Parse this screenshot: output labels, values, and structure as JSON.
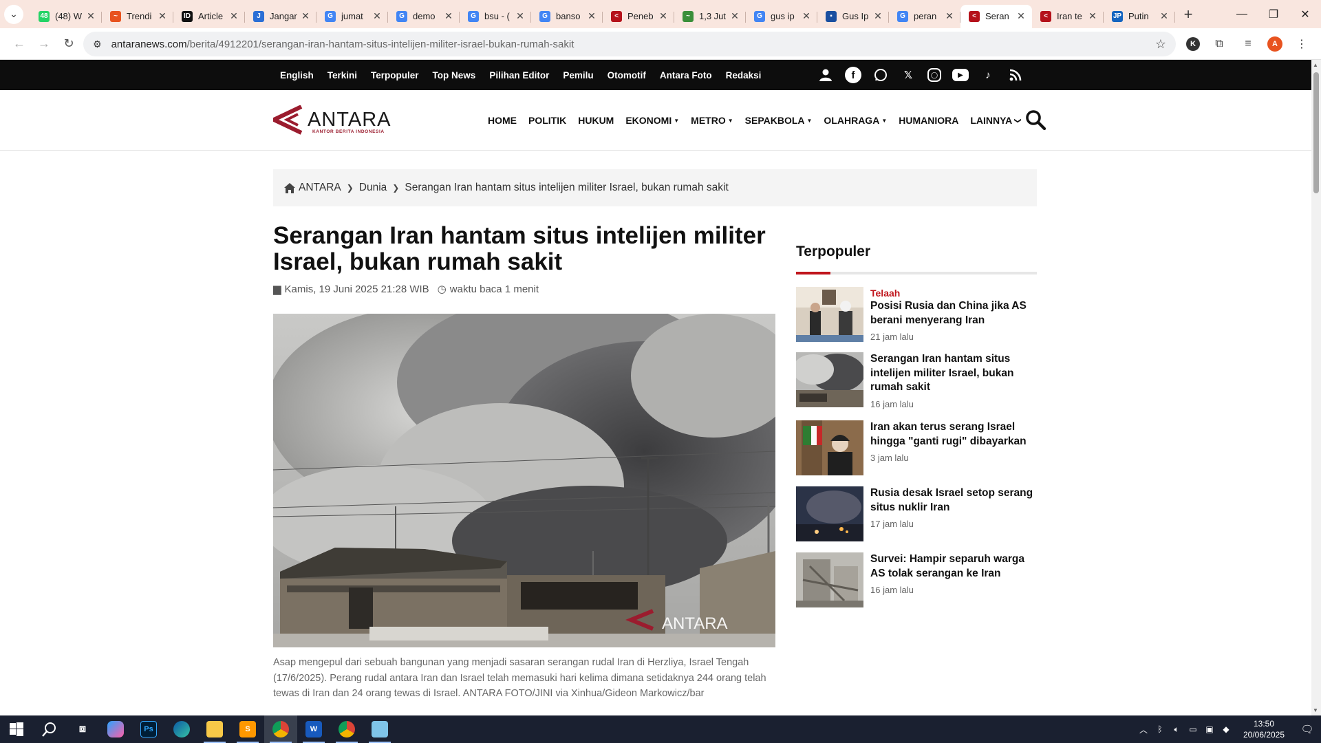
{
  "browser": {
    "tabs": [
      {
        "title": "(48) W",
        "fav_color": "#25d366",
        "fav_glyph": "48",
        "active": false
      },
      {
        "title": "Trendi",
        "fav_color": "#e8531f",
        "fav_glyph": "~",
        "active": false
      },
      {
        "title": "Article",
        "fav_color": "#111111",
        "fav_glyph": "ID",
        "active": false
      },
      {
        "title": "Jangar",
        "fav_color": "#2b6fd6",
        "fav_glyph": "J",
        "active": false
      },
      {
        "title": "jumat",
        "fav_color": "#4285f4",
        "fav_glyph": "G",
        "active": false
      },
      {
        "title": "demo",
        "fav_color": "#4285f4",
        "fav_glyph": "G",
        "active": false
      },
      {
        "title": "bsu - (",
        "fav_color": "#4285f4",
        "fav_glyph": "G",
        "active": false
      },
      {
        "title": "banso",
        "fav_color": "#4285f4",
        "fav_glyph": "G",
        "active": false
      },
      {
        "title": "Peneb",
        "fav_color": "#b5121b",
        "fav_glyph": "<",
        "active": false
      },
      {
        "title": "1,3 Jut",
        "fav_color": "#3a8f3a",
        "fav_glyph": "~",
        "active": false
      },
      {
        "title": "gus ip",
        "fav_color": "#4285f4",
        "fav_glyph": "G",
        "active": false
      },
      {
        "title": "Gus Ip",
        "fav_color": "#1a4fa0",
        "fav_glyph": "▪",
        "active": false
      },
      {
        "title": "peran",
        "fav_color": "#4285f4",
        "fav_glyph": "G",
        "active": false
      },
      {
        "title": "Seran",
        "fav_color": "#b5121b",
        "fav_glyph": "<",
        "active": true
      },
      {
        "title": "Iran te",
        "fav_color": "#b5121b",
        "fav_glyph": "<",
        "active": false
      },
      {
        "title": "Putin",
        "fav_color": "#1565c0",
        "fav_glyph": "JP",
        "active": false
      }
    ],
    "url_host": "antaranews.com",
    "url_path": "/berita/4912201/serangan-iran-hantam-situs-intelijen-militer-israel-bukan-rumah-sakit",
    "profile_initial": "A",
    "extension_initial": "K"
  },
  "topnav": [
    "English",
    "Terkini",
    "Terpopuler",
    "Top News",
    "Pilihan Editor",
    "Pemilu",
    "Otomotif",
    "Antara Foto",
    "Redaksi"
  ],
  "logo": {
    "name": "ANTARA",
    "tagline": "KANTOR BERITA INDONESIA",
    "accent": "#9b1c2e"
  },
  "mainnav": [
    {
      "label": "HOME",
      "dropdown": false
    },
    {
      "label": "POLITIK",
      "dropdown": false
    },
    {
      "label": "HUKUM",
      "dropdown": false
    },
    {
      "label": "EKONOMI",
      "dropdown": true
    },
    {
      "label": "METRO",
      "dropdown": true
    },
    {
      "label": "SEPAKBOLA",
      "dropdown": true
    },
    {
      "label": "OLAHRAGA",
      "dropdown": true
    },
    {
      "label": "HUMANIORA",
      "dropdown": false
    },
    {
      "label": "LAINNYA",
      "dropdown": true
    }
  ],
  "breadcrumb": [
    "ANTARA",
    "Dunia",
    "Serangan Iran hantam situs intelijen militer Israel, bukan rumah sakit"
  ],
  "article": {
    "title": "Serangan Iran hantam situs intelijen militer Israel, bukan rumah sakit",
    "date": "Kamis, 19 Juni 2025 21:28 WIB",
    "read_time": "waktu baca 1 menit",
    "image_watermark": "ANTARA",
    "caption": "Asap mengepul dari sebuah bangunan yang menjadi sasaran serangan rudal Iran di Herzliya, Israel Tengah (17/6/2025). Perang rudal antara Iran dan Israel telah memasuki hari kelima dimana setidaknya 244 orang telah tewas di Iran dan 24 orang tewas di Israel. ANTARA FOTO/JINI via Xinhua/Gideon Markowicz/bar"
  },
  "sidebar": {
    "heading": "Terpopuler",
    "items": [
      {
        "kicker": "Telaah",
        "title": "Posisi Rusia dan China jika AS berani menyerang Iran",
        "time": "21 jam lalu"
      },
      {
        "kicker": "",
        "title": "Serangan Iran hantam situs intelijen militer Israel, bukan rumah sakit",
        "time": "16 jam lalu"
      },
      {
        "kicker": "",
        "title": "Iran akan terus serang Israel hingga \"ganti rugi\" dibayarkan",
        "time": "3 jam lalu"
      },
      {
        "kicker": "",
        "title": "Rusia desak Israel setop serang situs nuklir Iran",
        "time": "17 jam lalu"
      },
      {
        "kicker": "",
        "title": "Survei: Hampir separuh warga AS tolak serangan ke Iran",
        "time": "16 jam lalu"
      }
    ]
  },
  "taskbar": {
    "time": "13:50",
    "date": "20/06/2025",
    "apps": [
      "start",
      "search",
      "task-view",
      "copilot",
      "photoshop",
      "edge",
      "file-explorer",
      "sublime-text",
      "chrome",
      "word",
      "chrome-2",
      "notepad"
    ]
  }
}
